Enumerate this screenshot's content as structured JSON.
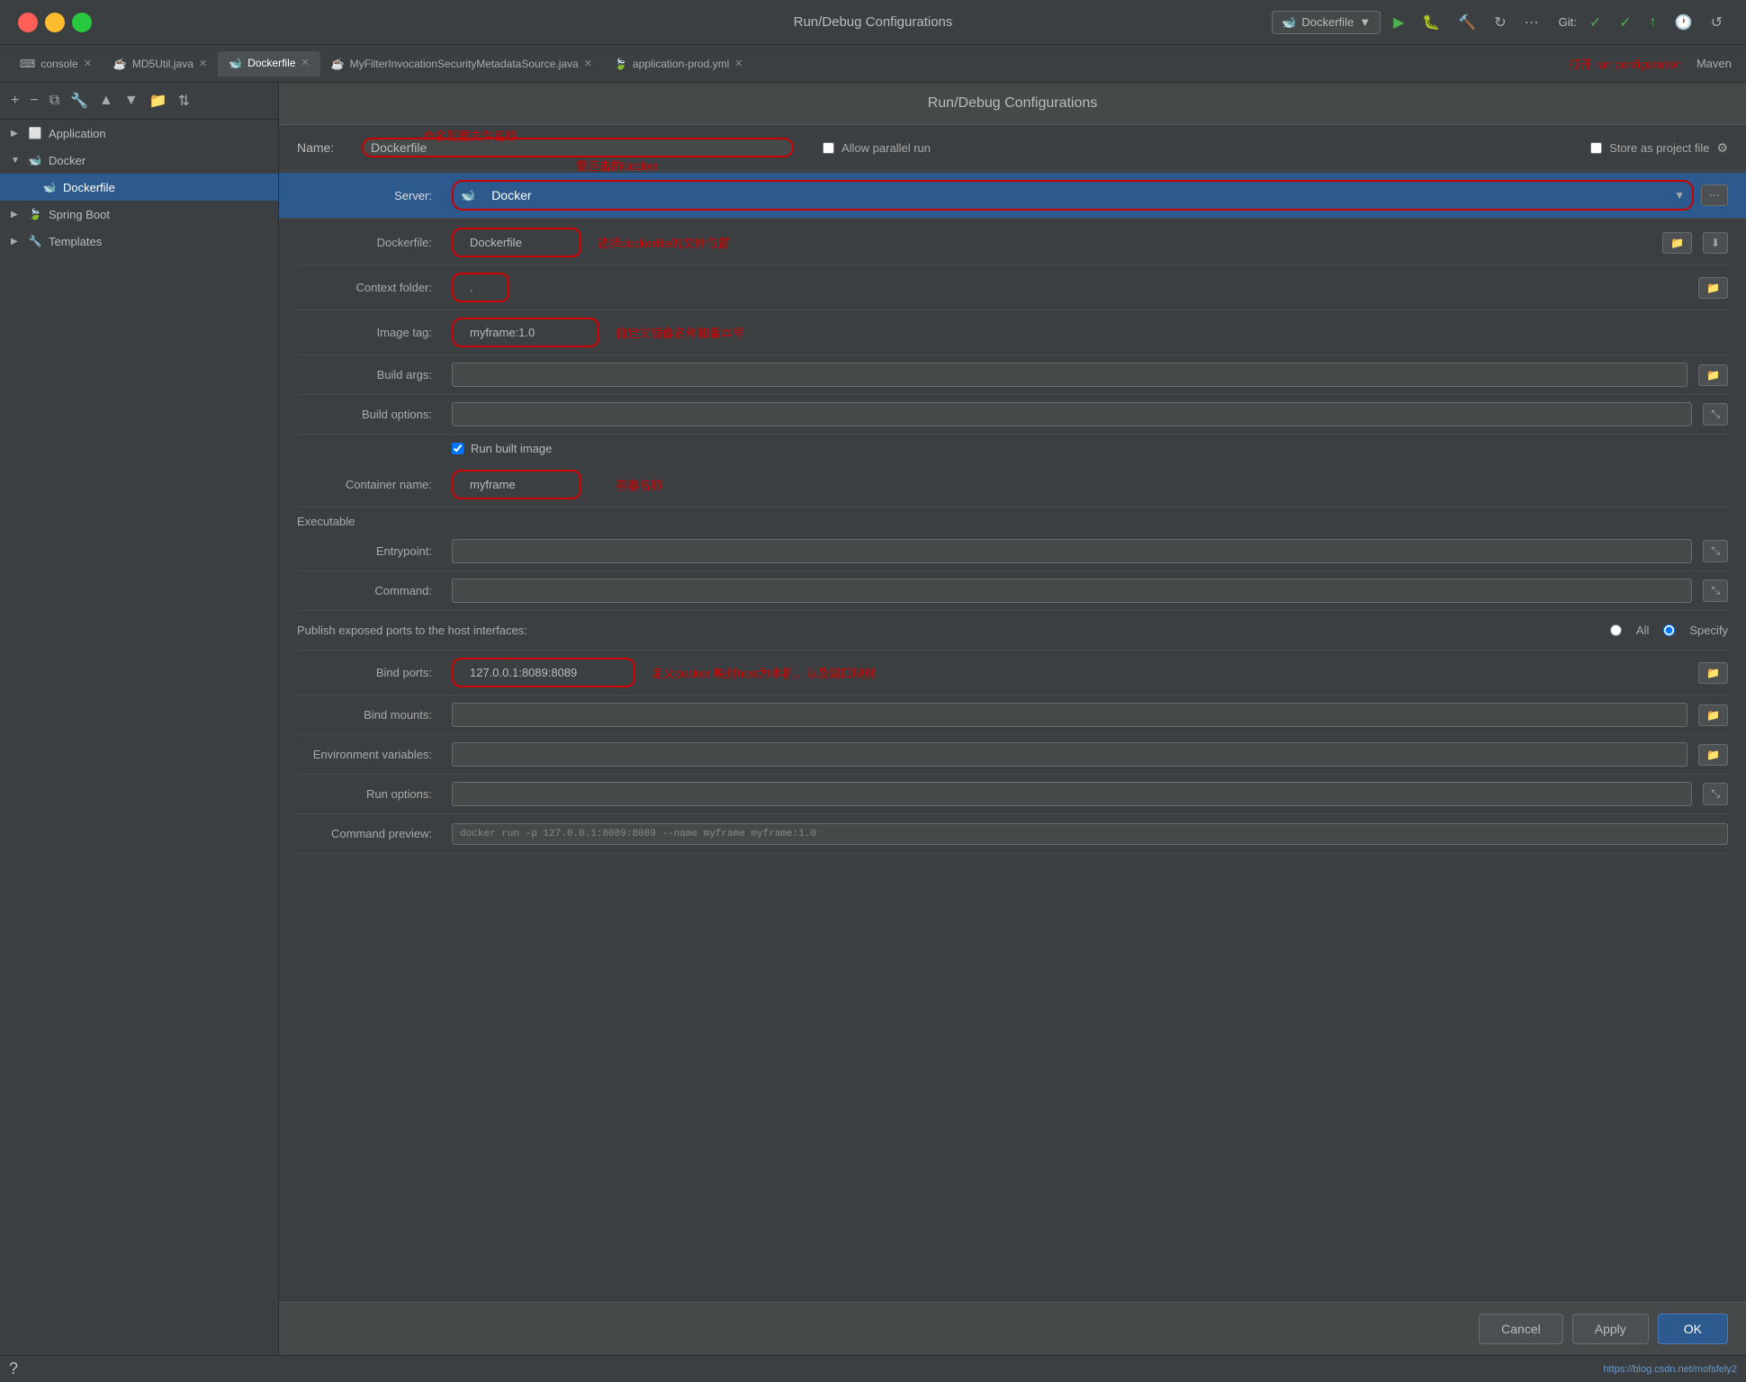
{
  "window": {
    "title": "Run/Debug Configurations",
    "titlebar_annotation": "打开 run configuration"
  },
  "tabs": [
    {
      "id": "console",
      "label": "console",
      "active": false
    },
    {
      "id": "md5util",
      "label": "MD5Util.java",
      "active": false
    },
    {
      "id": "dockerfile",
      "label": "Dockerfile",
      "active": true
    },
    {
      "id": "myfilter",
      "label": "MyFilterInvocationSecurityMetadataSource.java",
      "active": false
    },
    {
      "id": "application-prod",
      "label": "application-prod.yml",
      "active": false
    }
  ],
  "toolbar": {
    "run_config_label": "Dockerfile",
    "git_label": "Git:"
  },
  "sidebar": {
    "items": [
      {
        "id": "application",
        "label": "Application",
        "level": 0,
        "expanded": false,
        "icon": "app"
      },
      {
        "id": "docker",
        "label": "Docker",
        "level": 0,
        "expanded": true,
        "icon": "docker"
      },
      {
        "id": "dockerfile",
        "label": "Dockerfile",
        "level": 1,
        "expanded": false,
        "icon": "dockerfile",
        "selected": true
      },
      {
        "id": "spring-boot",
        "label": "Spring Boot",
        "level": 0,
        "expanded": false,
        "icon": "spring"
      },
      {
        "id": "templates",
        "label": "Templates",
        "level": 0,
        "expanded": false,
        "icon": "templates"
      }
    ]
  },
  "form": {
    "title": "Run/Debug Configurations",
    "name_label": "Name:",
    "name_value": "Dockerfile",
    "name_annotation": "命名配置文件名称",
    "allow_parallel_run_label": "Allow parallel run",
    "allow_parallel_run_checked": false,
    "store_as_project_file_label": "Store as project file",
    "store_as_project_file_checked": false,
    "server_label": "Server:",
    "server_value": "Docker",
    "server_annotation": "要连击的docker",
    "dockerfile_label": "Dockerfile:",
    "dockerfile_value": "Dockerfile",
    "dockerfile_annotation": "选择dockerfile的文件位置",
    "context_folder_label": "Context folder:",
    "context_folder_value": ".",
    "image_tag_label": "Image tag:",
    "image_tag_value": "myframe:1.0",
    "image_tag_annotation": "自定义镜像名称和版本号",
    "build_args_label": "Build args:",
    "build_args_value": "",
    "build_options_label": "Build options:",
    "build_options_value": "",
    "run_built_image_label": "Run built image",
    "run_built_image_checked": true,
    "container_name_label": "Container name:",
    "container_name_value": "myframe",
    "container_name_annotation": "容器名称",
    "executable_label": "Executable",
    "entrypoint_label": "Entrypoint:",
    "entrypoint_value": "",
    "command_label": "Command:",
    "command_value": "",
    "publish_ports_label": "Publish exposed ports to the host interfaces:",
    "publish_ports_all": "All",
    "publish_ports_specify": "Specify",
    "publish_ports_selected": "Specify",
    "bind_ports_label": "Bind ports:",
    "bind_ports_value": "127.0.0.1:8089:8089",
    "bind_ports_annotation": "定义docker 映射host为本机，以及端口映射",
    "bind_mounts_label": "Bind mounts:",
    "bind_mounts_value": "",
    "env_vars_label": "Environment variables:",
    "env_vars_value": "",
    "run_options_label": "Run options:",
    "run_options_value": "",
    "command_preview_label": "Command preview:",
    "command_preview_value": "docker run -p 127.0.0.1:8089:8089 --name myframe myframe:1.0"
  },
  "footer": {
    "cancel_label": "Cancel",
    "apply_label": "Apply",
    "ok_label": "OK"
  },
  "status": {
    "url": "https://blog.csdn.net/mofsfely2",
    "help_icon": "?"
  }
}
